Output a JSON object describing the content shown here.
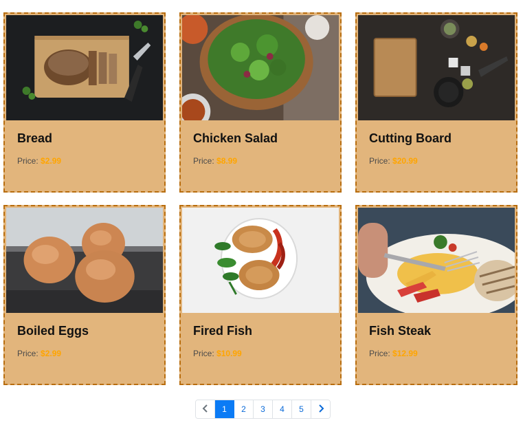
{
  "products": [
    {
      "name": "Bread",
      "price_label": "Price:",
      "price": "$2.99",
      "image": "bread-image"
    },
    {
      "name": "Chicken Salad",
      "price_label": "Price:",
      "price": "$8.99",
      "image": "salad-image"
    },
    {
      "name": "Cutting Board",
      "price_label": "Price:",
      "price": "$20.99",
      "image": "cutting-board-image"
    },
    {
      "name": "Boiled Eggs",
      "price_label": "Price:",
      "price": "$2.99",
      "image": "eggs-image"
    },
    {
      "name": "Fired Fish",
      "price_label": "Price:",
      "price": "$10.99",
      "image": "fried-fish-image"
    },
    {
      "name": "Fish Steak",
      "price_label": "Price:",
      "price": "$12.99",
      "image": "fish-steak-image"
    }
  ],
  "pagination": {
    "prev_icon": "chevron-left-icon",
    "next_icon": "chevron-right-icon",
    "pages": [
      "1",
      "2",
      "3",
      "4",
      "5"
    ],
    "current": "1"
  },
  "colors": {
    "card_bg": "#e2b57c",
    "card_border": "#b86d0e",
    "price_accent": "#ffa500",
    "page_active": "#0b7bf5",
    "page_link": "#0a6ad8"
  }
}
